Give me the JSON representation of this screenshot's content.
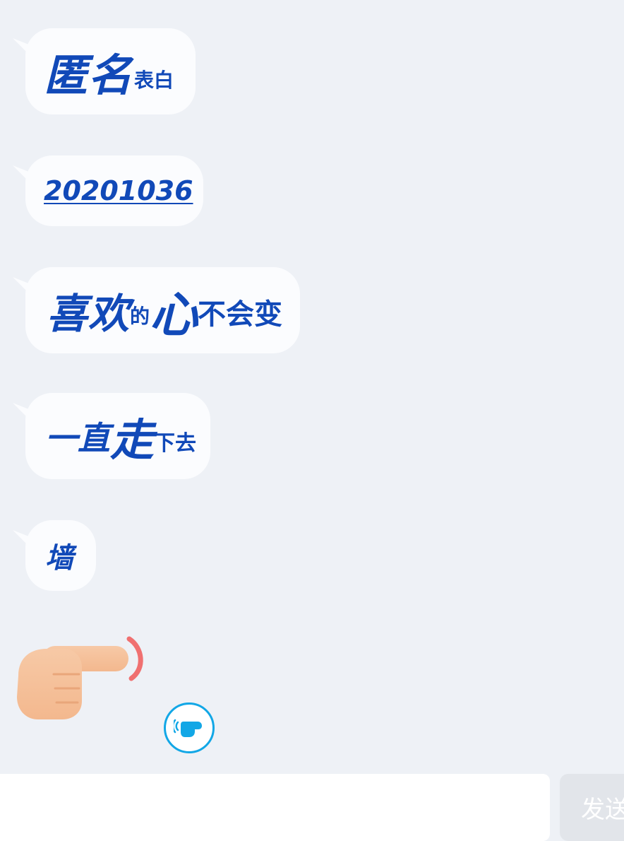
{
  "messages": [
    {
      "parts": [
        "匿名",
        "表白"
      ]
    },
    {
      "parts": [
        "20201036"
      ]
    },
    {
      "parts": [
        "喜欢",
        "的",
        "心",
        "不会变"
      ]
    },
    {
      "parts": [
        "一直",
        "走",
        "下去"
      ]
    },
    {
      "parts": [
        "墙"
      ]
    }
  ],
  "poke": {
    "icon": "pointing-hand-icon",
    "button_icon": "poke-icon"
  },
  "input": {
    "value": "",
    "placeholder": ""
  },
  "send": {
    "label": "发送"
  },
  "colors": {
    "background": "#eef1f6",
    "bubble": "#fbfcfe",
    "text": "#1149b8",
    "accent": "#12a7e6",
    "send_disabled": "#e2e5ea"
  }
}
